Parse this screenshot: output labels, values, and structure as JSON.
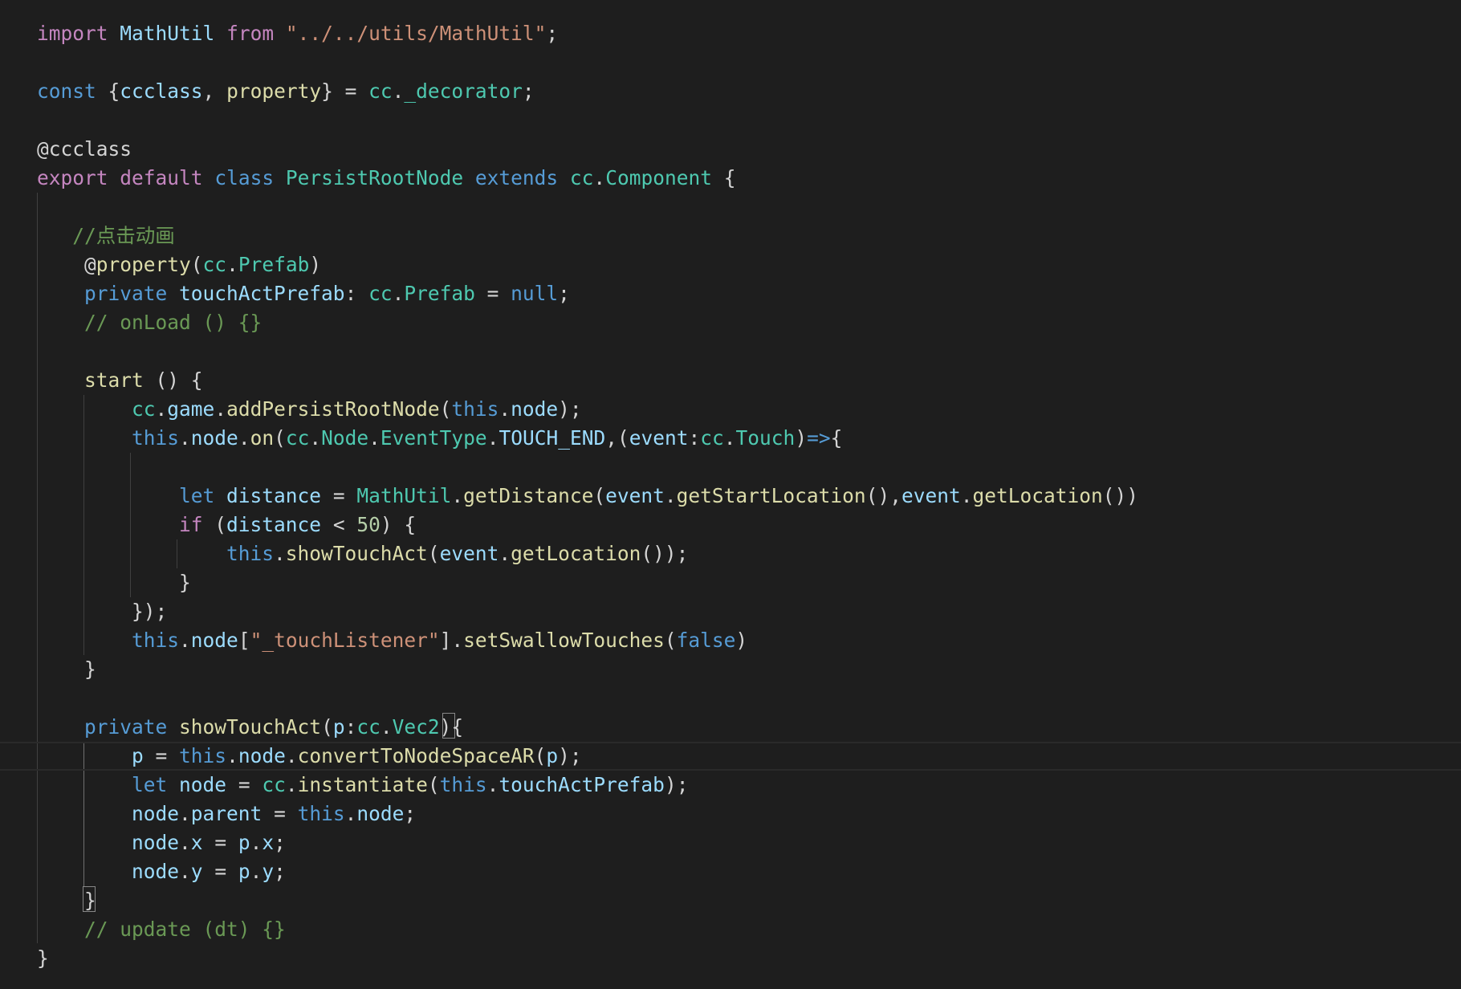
{
  "editor": {
    "theme": "dark",
    "colors": {
      "background": "#1e1e1e",
      "keyword_control": "#c586c0",
      "keyword": "#569cd6",
      "type": "#4ec9b0",
      "function": "#dcdcaa",
      "variable": "#9cdcfe",
      "string": "#ce9178",
      "number": "#b5cea8",
      "comment": "#6a9955",
      "punctuation": "#d4d4d4"
    },
    "lines": [
      [
        [
          "import",
          "kw-ctrl"
        ],
        [
          " ",
          "pun"
        ],
        [
          "MathUtil",
          "var"
        ],
        [
          " ",
          "pun"
        ],
        [
          "from",
          "kw-ctrl"
        ],
        [
          " ",
          "pun"
        ],
        [
          "\"../../utils/MathUtil\"",
          "str"
        ],
        [
          ";",
          "pun"
        ]
      ],
      [],
      [
        [
          "const",
          "kw"
        ],
        [
          " {",
          "pun"
        ],
        [
          "ccclass",
          "var"
        ],
        [
          ", ",
          "pun"
        ],
        [
          "property",
          "fn"
        ],
        [
          "} = ",
          "pun"
        ],
        [
          "cc",
          "cls"
        ],
        [
          ".",
          "pun"
        ],
        [
          "_decorator",
          "cls"
        ],
        [
          ";",
          "pun"
        ]
      ],
      [],
      [
        [
          "@ccclass",
          "dec"
        ]
      ],
      [
        [
          "export",
          "kw-ctrl"
        ],
        [
          " ",
          "pun"
        ],
        [
          "default",
          "kw-ctrl"
        ],
        [
          " ",
          "pun"
        ],
        [
          "class",
          "kw"
        ],
        [
          " ",
          "pun"
        ],
        [
          "PersistRootNode",
          "cls"
        ],
        [
          " ",
          "pun"
        ],
        [
          "extends",
          "kw"
        ],
        [
          " ",
          "pun"
        ],
        [
          "cc",
          "cls"
        ],
        [
          ".",
          "pun"
        ],
        [
          "Component",
          "cls"
        ],
        [
          " {",
          "pun"
        ]
      ],
      [],
      [
        [
          "   //点击动画",
          "cmt"
        ]
      ],
      [
        [
          "    @",
          "pun"
        ],
        [
          "property",
          "fn"
        ],
        [
          "(",
          "pun"
        ],
        [
          "cc",
          "cls"
        ],
        [
          ".",
          "pun"
        ],
        [
          "Prefab",
          "cls"
        ],
        [
          ")",
          "pun"
        ]
      ],
      [
        [
          "    ",
          "pun"
        ],
        [
          "private",
          "kw"
        ],
        [
          " ",
          "pun"
        ],
        [
          "touchActPrefab",
          "var"
        ],
        [
          ": ",
          "pun"
        ],
        [
          "cc",
          "cls"
        ],
        [
          ".",
          "pun"
        ],
        [
          "Prefab",
          "cls"
        ],
        [
          " = ",
          "pun"
        ],
        [
          "null",
          "kw"
        ],
        [
          ";",
          "pun"
        ]
      ],
      [
        [
          "    // onLoad () {}",
          "cmt"
        ]
      ],
      [],
      [
        [
          "    ",
          "pun"
        ],
        [
          "start",
          "fn"
        ],
        [
          " () {",
          "pun"
        ]
      ],
      [
        [
          "        ",
          "pun"
        ],
        [
          "cc",
          "cls"
        ],
        [
          ".",
          "pun"
        ],
        [
          "game",
          "var"
        ],
        [
          ".",
          "pun"
        ],
        [
          "addPersistRootNode",
          "fn"
        ],
        [
          "(",
          "pun"
        ],
        [
          "this",
          "kw"
        ],
        [
          ".",
          "pun"
        ],
        [
          "node",
          "var"
        ],
        [
          ");",
          "pun"
        ]
      ],
      [
        [
          "        ",
          "pun"
        ],
        [
          "this",
          "kw"
        ],
        [
          ".",
          "pun"
        ],
        [
          "node",
          "var"
        ],
        [
          ".",
          "pun"
        ],
        [
          "on",
          "fn"
        ],
        [
          "(",
          "pun"
        ],
        [
          "cc",
          "cls"
        ],
        [
          ".",
          "pun"
        ],
        [
          "Node",
          "cls"
        ],
        [
          ".",
          "pun"
        ],
        [
          "EventType",
          "cls"
        ],
        [
          ".",
          "pun"
        ],
        [
          "TOUCH_END",
          "var"
        ],
        [
          ",(",
          "pun"
        ],
        [
          "event",
          "var"
        ],
        [
          ":",
          "pun"
        ],
        [
          "cc",
          "cls"
        ],
        [
          ".",
          "pun"
        ],
        [
          "Touch",
          "cls"
        ],
        [
          ")",
          "pun"
        ],
        [
          "=>",
          "kw"
        ],
        [
          "{",
          "pun"
        ]
      ],
      [],
      [
        [
          "            ",
          "pun"
        ],
        [
          "let",
          "kw"
        ],
        [
          " ",
          "pun"
        ],
        [
          "distance",
          "var"
        ],
        [
          " = ",
          "pun"
        ],
        [
          "MathUtil",
          "cls"
        ],
        [
          ".",
          "pun"
        ],
        [
          "getDistance",
          "fn"
        ],
        [
          "(",
          "pun"
        ],
        [
          "event",
          "var"
        ],
        [
          ".",
          "pun"
        ],
        [
          "getStartLocation",
          "fn"
        ],
        [
          "(),",
          "pun"
        ],
        [
          "event",
          "var"
        ],
        [
          ".",
          "pun"
        ],
        [
          "getLocation",
          "fn"
        ],
        [
          "())",
          "pun"
        ]
      ],
      [
        [
          "            ",
          "pun"
        ],
        [
          "if",
          "kw-ctrl"
        ],
        [
          " (",
          "pun"
        ],
        [
          "distance",
          "var"
        ],
        [
          " < ",
          "pun"
        ],
        [
          "50",
          "num"
        ],
        [
          ") {",
          "pun"
        ]
      ],
      [
        [
          "                ",
          "pun"
        ],
        [
          "this",
          "kw"
        ],
        [
          ".",
          "pun"
        ],
        [
          "showTouchAct",
          "fn"
        ],
        [
          "(",
          "pun"
        ],
        [
          "event",
          "var"
        ],
        [
          ".",
          "pun"
        ],
        [
          "getLocation",
          "fn"
        ],
        [
          "());",
          "pun"
        ]
      ],
      [
        [
          "            }",
          "pun"
        ]
      ],
      [
        [
          "        });",
          "pun"
        ]
      ],
      [
        [
          "        ",
          "pun"
        ],
        [
          "this",
          "kw"
        ],
        [
          ".",
          "pun"
        ],
        [
          "node",
          "var"
        ],
        [
          "[",
          "pun"
        ],
        [
          "\"_touchListener\"",
          "str"
        ],
        [
          "].",
          "pun"
        ],
        [
          "setSwallowTouches",
          "fn"
        ],
        [
          "(",
          "pun"
        ],
        [
          "false",
          "kw"
        ],
        [
          ")",
          "pun"
        ]
      ],
      [
        [
          "    }",
          "pun"
        ]
      ],
      [],
      [
        [
          "    ",
          "pun"
        ],
        [
          "private",
          "kw"
        ],
        [
          " ",
          "pun"
        ],
        [
          "showTouchAct",
          "fn"
        ],
        [
          "(",
          "pun"
        ],
        [
          "p",
          "var"
        ],
        [
          ":",
          "pun"
        ],
        [
          "cc",
          "cls"
        ],
        [
          ".",
          "pun"
        ],
        [
          "Vec2",
          "cls"
        ],
        [
          "){",
          "pun"
        ]
      ],
      [
        [
          "        ",
          "pun"
        ],
        [
          "p",
          "var"
        ],
        [
          " = ",
          "pun"
        ],
        [
          "this",
          "kw"
        ],
        [
          ".",
          "pun"
        ],
        [
          "node",
          "var"
        ],
        [
          ".",
          "pun"
        ],
        [
          "convertToNodeSpaceAR",
          "fn"
        ],
        [
          "(",
          "pun"
        ],
        [
          "p",
          "var"
        ],
        [
          ");",
          "pun"
        ]
      ],
      [
        [
          "        ",
          "pun"
        ],
        [
          "let",
          "kw"
        ],
        [
          " ",
          "pun"
        ],
        [
          "node",
          "var"
        ],
        [
          " = ",
          "pun"
        ],
        [
          "cc",
          "cls"
        ],
        [
          ".",
          "pun"
        ],
        [
          "instantiate",
          "fn"
        ],
        [
          "(",
          "pun"
        ],
        [
          "this",
          "kw"
        ],
        [
          ".",
          "pun"
        ],
        [
          "touchActPrefab",
          "var"
        ],
        [
          ");",
          "pun"
        ]
      ],
      [
        [
          "        ",
          "pun"
        ],
        [
          "node",
          "var"
        ],
        [
          ".",
          "pun"
        ],
        [
          "parent",
          "var"
        ],
        [
          " = ",
          "pun"
        ],
        [
          "this",
          "kw"
        ],
        [
          ".",
          "pun"
        ],
        [
          "node",
          "var"
        ],
        [
          ";",
          "pun"
        ]
      ],
      [
        [
          "        ",
          "pun"
        ],
        [
          "node",
          "var"
        ],
        [
          ".",
          "pun"
        ],
        [
          "x",
          "var"
        ],
        [
          " = ",
          "pun"
        ],
        [
          "p",
          "var"
        ],
        [
          ".",
          "pun"
        ],
        [
          "x",
          "var"
        ],
        [
          ";",
          "pun"
        ]
      ],
      [
        [
          "        ",
          "pun"
        ],
        [
          "node",
          "var"
        ],
        [
          ".",
          "pun"
        ],
        [
          "y",
          "var"
        ],
        [
          " = ",
          "pun"
        ],
        [
          "p",
          "var"
        ],
        [
          ".",
          "pun"
        ],
        [
          "y",
          "var"
        ],
        [
          ";",
          "pun"
        ]
      ],
      [
        [
          "    }",
          "pun"
        ]
      ],
      [
        [
          "    // update (dt) {}",
          "cmt"
        ]
      ],
      [
        [
          "}",
          "pun"
        ]
      ]
    ]
  }
}
